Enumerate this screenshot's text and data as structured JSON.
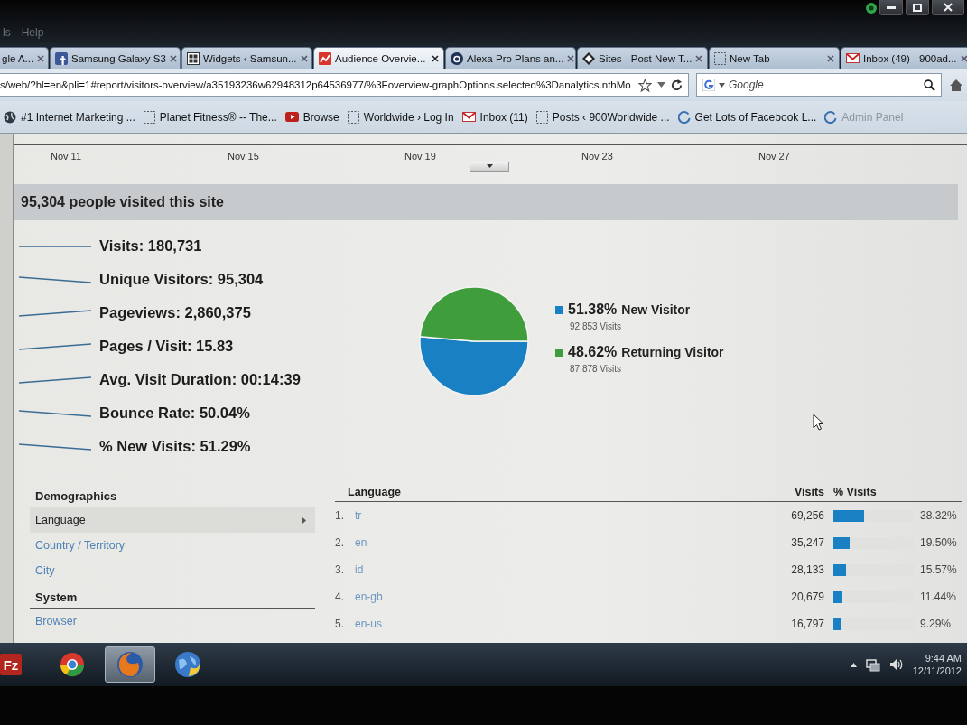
{
  "window": {
    "menu": [
      "ls",
      "Help"
    ]
  },
  "tabs": [
    {
      "title": "gle A...",
      "kind": "none",
      "selected": false
    },
    {
      "title": "Samsung Galaxy S3",
      "kind": "fbox",
      "selected": false
    },
    {
      "title": "Widgets ‹ Samsun...",
      "kind": "grid",
      "selected": false
    },
    {
      "title": "Audience Overvie...",
      "kind": "chart",
      "selected": true
    },
    {
      "title": "Alexa Pro Plans an...",
      "kind": "disc",
      "selected": false
    },
    {
      "title": "Sites - Post New T...",
      "kind": "diamond",
      "selected": false
    },
    {
      "title": "New Tab",
      "kind": "blank",
      "selected": false
    },
    {
      "title": "Inbox (49) - 900ad...",
      "kind": "mail",
      "selected": false
    }
  ],
  "toolbar": {
    "url": "s/web/?hl=en&pli=1#report/visitors-overview/a35193236w62948312p64536977/%3Foverview-graphOptions.selected%3Danalytics.nthMo",
    "search": {
      "placeholder": "Google"
    }
  },
  "bookmarks": [
    {
      "title": "#1 Internet Marketing ...",
      "kind": "globe"
    },
    {
      "title": "Planet Fitness® -- The...",
      "kind": "blank"
    },
    {
      "title": "Browse",
      "kind": "play"
    },
    {
      "title": "Worldwide › Log In",
      "kind": "blank"
    },
    {
      "title": "Inbox (11)",
      "kind": "mail"
    },
    {
      "title": "Posts ‹ 900Worldwide ...",
      "kind": "blank"
    },
    {
      "title": "Get Lots of Facebook L...",
      "kind": "ring"
    },
    {
      "title": "Admin Panel",
      "kind": "ring"
    }
  ],
  "timeline": {
    "date_labels": [
      "Nov 11",
      "Nov 15",
      "Nov 19",
      "Nov 23",
      "Nov 27"
    ]
  },
  "summary": {
    "title": "95,304 people visited this site",
    "metrics": [
      "Visits: 180,731",
      "Unique Visitors: 95,304",
      "Pageviews: 2,860,375",
      "Pages / Visit: 15.83",
      "Avg. Visit Duration: 00:14:39",
      "Bounce Rate: 50.04%",
      "% New Visits: 51.29%"
    ]
  },
  "visitor_pie": {
    "chart_data": {
      "type": "pie",
      "categories": [
        "New Visitor",
        "Returning Visitor"
      ],
      "values": [
        51.38,
        48.62
      ]
    },
    "legend": [
      {
        "color": "#1a80c4",
        "percent": "51.38%",
        "visits": "92,853 Visits"
      },
      {
        "color": "#3f9d3b",
        "percent": "48.62%",
        "visits": "87,878 Visits"
      }
    ]
  },
  "sidebar": {
    "sections": [
      {
        "title": "Demographics",
        "items": [
          {
            "label": "Language",
            "selected": true
          },
          {
            "label": "Country / Territory",
            "selected": false
          },
          {
            "label": "City",
            "selected": false
          }
        ]
      },
      {
        "title": "System",
        "items": [
          {
            "label": "Browser",
            "selected": false
          }
        ]
      }
    ]
  },
  "table": {
    "columns": [
      "Language",
      "Visits",
      "% Visits"
    ],
    "rows": [
      {
        "rank": "1.",
        "language": "tr",
        "visits": "69,256",
        "percent": "38.32%",
        "level": 0.3832
      },
      {
        "rank": "2.",
        "language": "en",
        "visits": "35,247",
        "percent": "19.50%",
        "level": 0.195
      },
      {
        "rank": "3.",
        "language": "id",
        "visits": "28,133",
        "percent": "15.57%",
        "level": 0.1557
      },
      {
        "rank": "4.",
        "language": "en-gb",
        "visits": "20,679",
        "percent": "11.44%",
        "level": 0.1144
      },
      {
        "rank": "5.",
        "language": "en-us",
        "visits": "16,797",
        "percent": "9.29%",
        "level": 0.0929
      }
    ]
  },
  "taskbar": {
    "apps": [
      {
        "kind": "tile",
        "label": "Fz",
        "selected": false
      },
      {
        "kind": "wheel",
        "selected": false
      },
      {
        "kind": "fox",
        "selected": true
      },
      {
        "kind": "globe",
        "selected": false
      }
    ],
    "clock": {
      "time": "9:44 AM",
      "date": "12/11/2012"
    }
  }
}
